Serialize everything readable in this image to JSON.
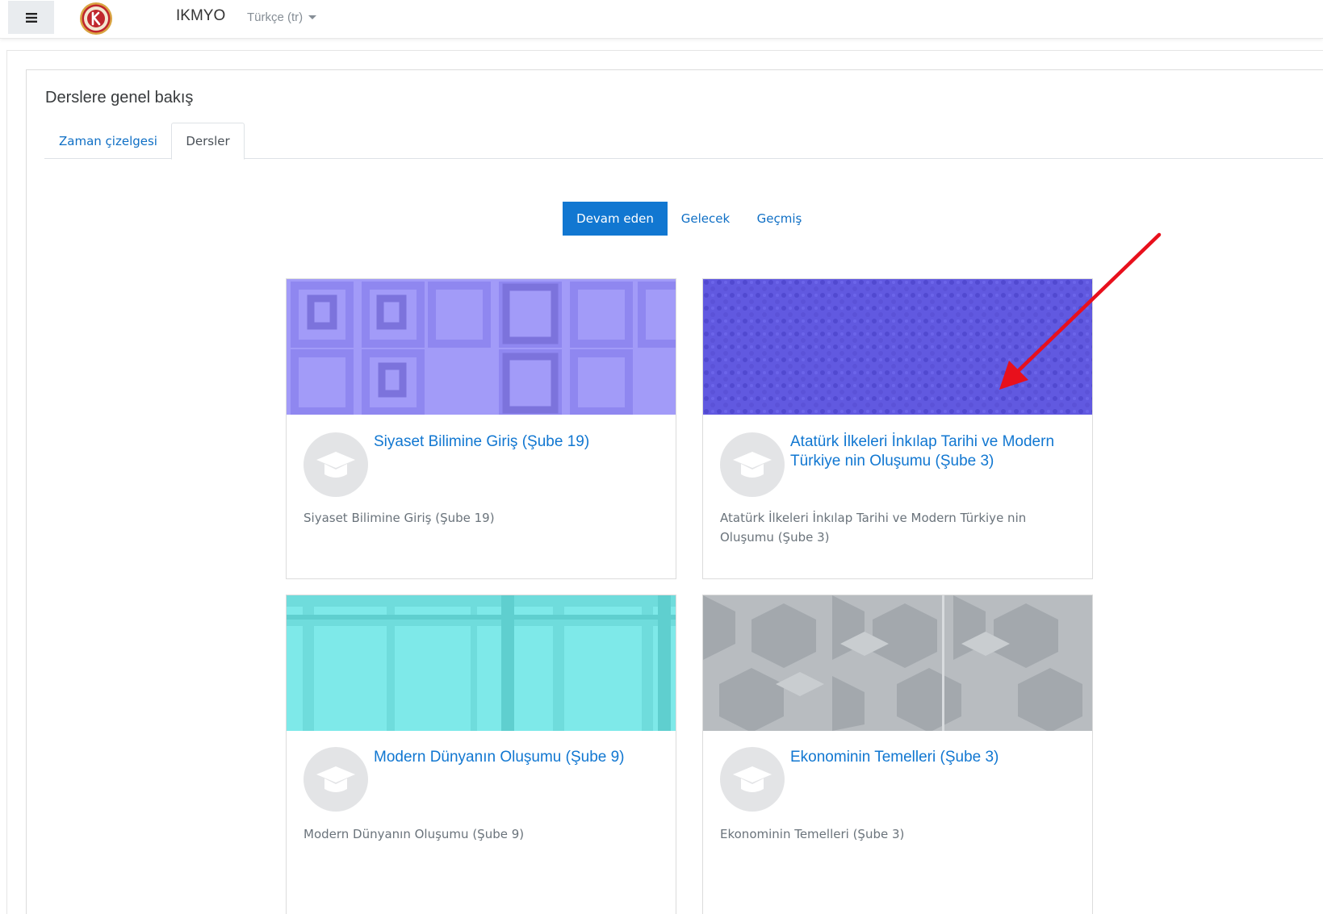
{
  "navbar": {
    "menu_icon": "hamburger-icon",
    "logo_icon": "institution-seal-icon",
    "site_name": "IKMYO",
    "language": "Türkçe (tr)",
    "language_caret_icon": "caret-down-icon"
  },
  "block": {
    "title": "Derslere genel bakış",
    "tabs": [
      {
        "label": "Zaman çizelgesi",
        "active": false
      },
      {
        "label": "Dersler",
        "active": true
      }
    ],
    "filters": [
      {
        "label": "Devam eden",
        "active": true
      },
      {
        "label": "Gelecek",
        "active": false
      },
      {
        "label": "Geçmiş",
        "active": false
      }
    ]
  },
  "courses": [
    {
      "name": "Siyaset Bilimine Giriş (Şube 19)",
      "summary": "Siyaset Bilimine Giriş (Şube 19)",
      "pattern_color": "#a29bf8",
      "icon": "graduation-cap-icon"
    },
    {
      "name": "Atatürk İlkeleri İnkılap Tarihi ve Modern Türkiye nin Oluşumu (Şube 3)",
      "summary": "Atatürk İlkeleri İnkılap Tarihi ve Modern Türkiye nin Oluşumu (Şube 3)",
      "pattern_color": "#6159e0",
      "icon": "graduation-cap-icon"
    },
    {
      "name": "Modern Dünyanın Oluşumu (Şube 9)",
      "summary": "Modern Dünyanın Oluşumu (Şube 9)",
      "pattern_color": "#7ee9e9",
      "icon": "graduation-cap-icon"
    },
    {
      "name": "Ekonominin Temelleri (Şube 3)",
      "summary": "Ekonominin Temelleri (Şube 3)",
      "pattern_color": "#b8bcc0",
      "icon": "graduation-cap-icon"
    }
  ],
  "colors": {
    "accent": "#1177d1",
    "annotation_arrow": "#e8101c"
  },
  "annotation": {
    "icon": "red-arrow-icon"
  }
}
